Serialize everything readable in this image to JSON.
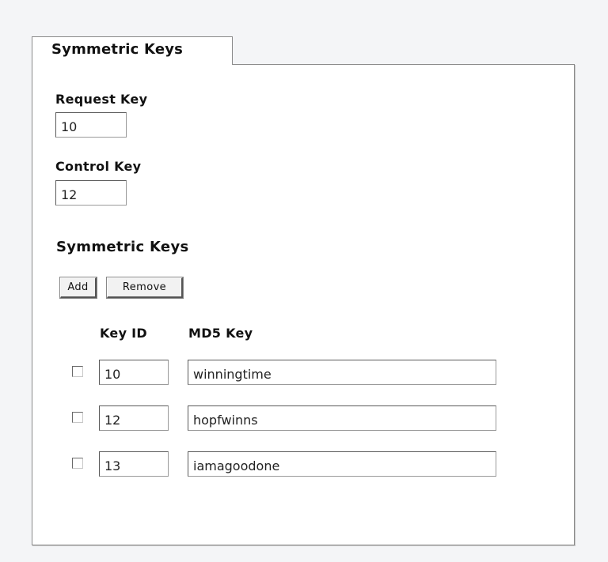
{
  "tab": {
    "label": "Symmetric Keys"
  },
  "request_key": {
    "label": "Request Key",
    "value": "10"
  },
  "control_key": {
    "label": "Control Key",
    "value": "12"
  },
  "symmetric_keys": {
    "heading": "Symmetric Keys",
    "add_label": "Add",
    "remove_label": "Remove",
    "columns": {
      "key_id": "Key ID",
      "md5_key": "MD5 Key"
    },
    "rows": [
      {
        "key_id": "10",
        "md5_key": "winningtime",
        "checked": false
      },
      {
        "key_id": "12",
        "md5_key": "hopfwinns",
        "checked": false
      },
      {
        "key_id": "13",
        "md5_key": "iamagoodone",
        "checked": false
      }
    ]
  }
}
